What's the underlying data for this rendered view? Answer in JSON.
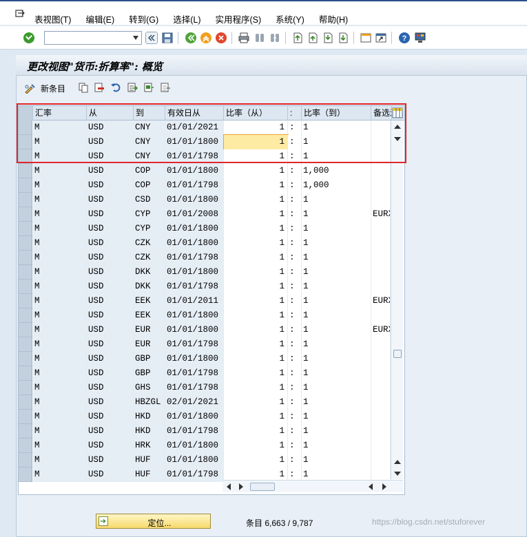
{
  "menu": {
    "items": [
      "表视图(T)",
      "编辑(E)",
      "转到(G)",
      "选择(L)",
      "实用程序(S)",
      "系统(Y)",
      "帮助(H)"
    ]
  },
  "toolbar": {
    "command_value": "",
    "icons": [
      "enter-icon",
      "command-dropdown-icon",
      "collapse-icon",
      "save-icon",
      "back-icon",
      "exit-icon",
      "cancel-icon",
      "print-icon",
      "find-icon",
      "find-next-icon",
      "first-page-icon",
      "previous-page-icon",
      "next-page-icon",
      "last-page-icon",
      "create-session-icon",
      "shortcut-icon",
      "help-icon",
      "customize-layout-icon"
    ]
  },
  "title": "更改视图\"货币:折算率\": 概览",
  "app_toolbar": {
    "new_entry_label": "新条目"
  },
  "table": {
    "columns": [
      "汇率",
      "从",
      "到",
      "有效日从",
      "比率（从）",
      ":",
      "比率（到）",
      "备选汇"
    ],
    "rows": [
      {
        "type": "M",
        "from": "USD",
        "to": "CNY",
        "date": "01/01/2021",
        "ratio_from": "1",
        "sep": ":",
        "ratio_to": "1",
        "alt": ""
      },
      {
        "type": "M",
        "from": "USD",
        "to": "CNY",
        "date": "01/01/1800",
        "ratio_from": "1",
        "sep": ":",
        "ratio_to": "1",
        "alt": ""
      },
      {
        "type": "M",
        "from": "USD",
        "to": "CNY",
        "date": "01/01/1798",
        "ratio_from": "1",
        "sep": ":",
        "ratio_to": "1",
        "alt": ""
      },
      {
        "type": "M",
        "from": "USD",
        "to": "COP",
        "date": "01/01/1800",
        "ratio_from": "1",
        "sep": ":",
        "ratio_to": "1,000",
        "alt": ""
      },
      {
        "type": "M",
        "from": "USD",
        "to": "COP",
        "date": "01/01/1798",
        "ratio_from": "1",
        "sep": ":",
        "ratio_to": "1,000",
        "alt": ""
      },
      {
        "type": "M",
        "from": "USD",
        "to": "CSD",
        "date": "01/01/1800",
        "ratio_from": "1",
        "sep": ":",
        "ratio_to": "1",
        "alt": ""
      },
      {
        "type": "M",
        "from": "USD",
        "to": "CYP",
        "date": "01/01/2008",
        "ratio_from": "1",
        "sep": ":",
        "ratio_to": "1",
        "alt": "EURX"
      },
      {
        "type": "M",
        "from": "USD",
        "to": "CYP",
        "date": "01/01/1800",
        "ratio_from": "1",
        "sep": ":",
        "ratio_to": "1",
        "alt": ""
      },
      {
        "type": "M",
        "from": "USD",
        "to": "CZK",
        "date": "01/01/1800",
        "ratio_from": "1",
        "sep": ":",
        "ratio_to": "1",
        "alt": ""
      },
      {
        "type": "M",
        "from": "USD",
        "to": "CZK",
        "date": "01/01/1798",
        "ratio_from": "1",
        "sep": ":",
        "ratio_to": "1",
        "alt": ""
      },
      {
        "type": "M",
        "from": "USD",
        "to": "DKK",
        "date": "01/01/1800",
        "ratio_from": "1",
        "sep": ":",
        "ratio_to": "1",
        "alt": ""
      },
      {
        "type": "M",
        "from": "USD",
        "to": "DKK",
        "date": "01/01/1798",
        "ratio_from": "1",
        "sep": ":",
        "ratio_to": "1",
        "alt": ""
      },
      {
        "type": "M",
        "from": "USD",
        "to": "EEK",
        "date": "01/01/2011",
        "ratio_from": "1",
        "sep": ":",
        "ratio_to": "1",
        "alt": "EURX"
      },
      {
        "type": "M",
        "from": "USD",
        "to": "EEK",
        "date": "01/01/1800",
        "ratio_from": "1",
        "sep": ":",
        "ratio_to": "1",
        "alt": ""
      },
      {
        "type": "M",
        "from": "USD",
        "to": "EUR",
        "date": "01/01/1800",
        "ratio_from": "1",
        "sep": ":",
        "ratio_to": "1",
        "alt": "EURX"
      },
      {
        "type": "M",
        "from": "USD",
        "to": "EUR",
        "date": "01/01/1798",
        "ratio_from": "1",
        "sep": ":",
        "ratio_to": "1",
        "alt": ""
      },
      {
        "type": "M",
        "from": "USD",
        "to": "GBP",
        "date": "01/01/1800",
        "ratio_from": "1",
        "sep": ":",
        "ratio_to": "1",
        "alt": ""
      },
      {
        "type": "M",
        "from": "USD",
        "to": "GBP",
        "date": "01/01/1798",
        "ratio_from": "1",
        "sep": ":",
        "ratio_to": "1",
        "alt": ""
      },
      {
        "type": "M",
        "from": "USD",
        "to": "GHS",
        "date": "01/01/1798",
        "ratio_from": "1",
        "sep": ":",
        "ratio_to": "1",
        "alt": ""
      },
      {
        "type": "M",
        "from": "USD",
        "to": "HBZGL",
        "date": "02/01/2021",
        "ratio_from": "1",
        "sep": ":",
        "ratio_to": "1",
        "alt": ""
      },
      {
        "type": "M",
        "from": "USD",
        "to": "HKD",
        "date": "01/01/1800",
        "ratio_from": "1",
        "sep": ":",
        "ratio_to": "1",
        "alt": ""
      },
      {
        "type": "M",
        "from": "USD",
        "to": "HKD",
        "date": "01/01/1798",
        "ratio_from": "1",
        "sep": ":",
        "ratio_to": "1",
        "alt": ""
      },
      {
        "type": "M",
        "from": "USD",
        "to": "HRK",
        "date": "01/01/1800",
        "ratio_from": "1",
        "sep": ":",
        "ratio_to": "1",
        "alt": ""
      },
      {
        "type": "M",
        "from": "USD",
        "to": "HUF",
        "date": "01/01/1800",
        "ratio_from": "1",
        "sep": ":",
        "ratio_to": "1",
        "alt": ""
      },
      {
        "type": "M",
        "from": "USD",
        "to": "HUF",
        "date": "01/01/1798",
        "ratio_from": "1",
        "sep": ":",
        "ratio_to": "1",
        "alt": ""
      }
    ],
    "focused_row": 1
  },
  "footer": {
    "position_button": "定位...",
    "entry_count": "条目 6,663 / 9,787"
  },
  "watermark": "https://blog.csdn.net/stuforever",
  "colors": {
    "highlight_border": "#e0262a",
    "focus_cell": "#fdeba4",
    "header_bg": "#dde7f1",
    "position_button": "#f7d96d"
  }
}
